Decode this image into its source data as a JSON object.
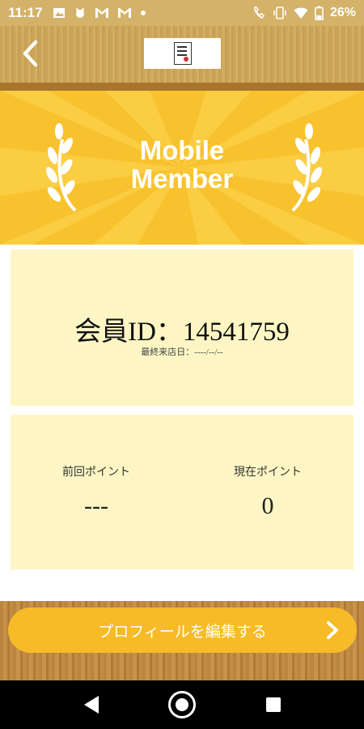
{
  "status_bar": {
    "time": "11:17",
    "battery": "26%",
    "left_icons": [
      "image-icon",
      "cat-icon",
      "gmail-icon",
      "gmail-icon",
      "dot-icon"
    ],
    "right_icons": [
      "wifi-calling-icon",
      "vibrate-icon",
      "wifi-icon",
      "battery-icon"
    ]
  },
  "header": {
    "back_icon": "chevron-left-icon",
    "logo": "store-logo"
  },
  "banner": {
    "title_line1": "Mobile",
    "title_line2": "Member",
    "colors": {
      "background": "#f8c22e",
      "text": "#ffffff"
    }
  },
  "member": {
    "id_text": "会員ID：14541759",
    "last_visit": "最終来店日：----/--/--"
  },
  "points": {
    "previous_label": "前回ポイント",
    "previous_value": "---",
    "current_label": "現在ポイント",
    "current_value": "0"
  },
  "footer": {
    "edit_profile_label": "プロフィールを編集する",
    "button_color": "#f6bb26"
  },
  "nav_bar": {
    "buttons": [
      "back-icon",
      "home-icon",
      "recents-icon"
    ]
  }
}
